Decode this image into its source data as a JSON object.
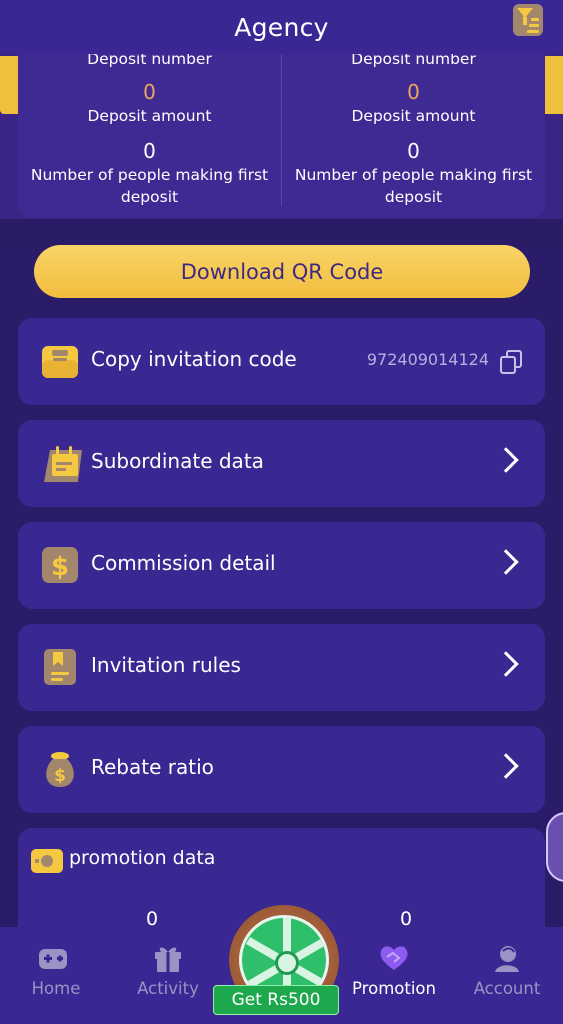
{
  "header": {
    "title": "Agency",
    "filter_icon": "filter-icon"
  },
  "stats": {
    "left": {
      "deposit_number_label": "Deposit number",
      "deposit_number_value": "0",
      "deposit_amount_label": "Deposit amount",
      "deposit_amount_value": "0",
      "first_deposit_label": "Number of people making first deposit"
    },
    "right": {
      "deposit_number_label": "Deposit number",
      "deposit_number_value": "0",
      "deposit_amount_label": "Deposit amount",
      "deposit_amount_value": "0",
      "first_deposit_label": "Number of people making first deposit"
    }
  },
  "qr_button": {
    "label": "Download QR Code"
  },
  "menu": {
    "copy_code": {
      "label": "Copy invitation code",
      "code": "972409014124",
      "icon": "inbox-icon"
    },
    "subordinate": {
      "label": "Subordinate data",
      "icon": "calendar-icon"
    },
    "commission": {
      "label": "Commission detail",
      "icon": "dollar-icon"
    },
    "rules": {
      "label": "Invitation rules",
      "icon": "document-icon"
    },
    "rebate": {
      "label": "Rebate ratio",
      "icon": "money-bag-icon"
    }
  },
  "promotion": {
    "title": "promotion data",
    "values": [
      "0",
      "0"
    ]
  },
  "floating": {
    "label": "Get Rs500"
  },
  "tabs": [
    {
      "label": "Home",
      "icon": "gamepad-icon"
    },
    {
      "label": "Activity",
      "icon": "gift-icon"
    },
    {
      "label": "Promotion",
      "icon": "heart-handshake-icon"
    },
    {
      "label": "Account",
      "icon": "user-icon"
    }
  ],
  "colors": {
    "background": "#2b1c69",
    "card": "#3a2892",
    "accent_gold": "#f2bd3e",
    "orange_value": "#f0a35a",
    "tab_inactive": "#9a93c4"
  }
}
